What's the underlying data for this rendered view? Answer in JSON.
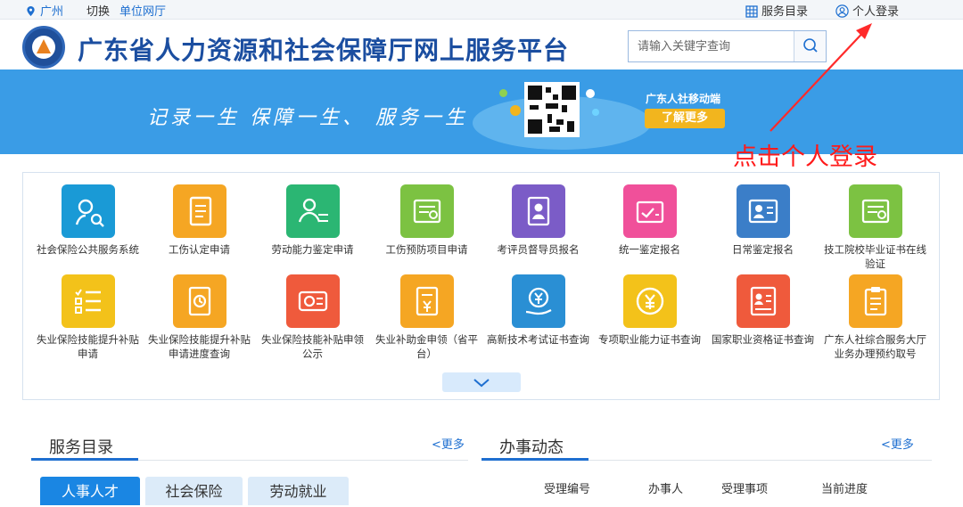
{
  "topbar": {
    "city": "广州",
    "switch": "切换",
    "unit_hall": "单位网厅",
    "service_catalog": "服务目录",
    "personal_login": "个人登录"
  },
  "header": {
    "title": "广东省人力资源和社会保障厅网上服务平台",
    "search_placeholder": "请输入关键字查询"
  },
  "banner": {
    "slogan": "记录一生  保障一生、 服务一生",
    "mobile_label": "广东人社移动端",
    "learn_more": "了解更多"
  },
  "annotation": {
    "text": "点击个人登录",
    "color": "#ff1a1a"
  },
  "services": [
    {
      "label": "社会保险公共服务系统",
      "icon": "search-user-icon",
      "color": "#1a9ad6"
    },
    {
      "label": "工伤认定申请",
      "icon": "document-icon",
      "color": "#f5a623"
    },
    {
      "label": "劳动能力鉴定申请",
      "icon": "users-exchange-icon",
      "color": "#2bb673"
    },
    {
      "label": "工伤预防项目申请",
      "icon": "certificate-icon",
      "color": "#7cc242"
    },
    {
      "label": "考评员督导员报名",
      "icon": "id-badge-icon",
      "color": "#7b5cc7"
    },
    {
      "label": "统一鉴定报名",
      "icon": "signup-card-icon",
      "color": "#f0509a"
    },
    {
      "label": "日常鉴定报名",
      "icon": "profile-card-icon",
      "color": "#3b7ec8"
    },
    {
      "label": "技工院校毕业证书在线验证",
      "icon": "diploma-icon",
      "color": "#7cc242"
    },
    {
      "label": "失业保险技能提升补贴申请",
      "icon": "checklist-icon",
      "color": "#f3c21a"
    },
    {
      "label": "失业保险技能提升补贴申请进度查询",
      "icon": "progress-doc-icon",
      "color": "#f5a623"
    },
    {
      "label": "失业保险技能补贴申领公示",
      "icon": "bank-card-icon",
      "color": "#ef5a3c"
    },
    {
      "label": "失业补助金申领（省平台）",
      "icon": "yuan-doc-icon",
      "color": "#f5a623"
    },
    {
      "label": "高新技术考试证书查询",
      "icon": "yuan-hand-icon",
      "color": "#2a8fd4"
    },
    {
      "label": "专项职业能力证书查询",
      "icon": "yuan-coin-icon",
      "color": "#f3c21a"
    },
    {
      "label": "国家职业资格证书查询",
      "icon": "id-card-icon",
      "color": "#ef5a3c"
    },
    {
      "label": "广东人社综合服务大厅业务办理预约取号",
      "icon": "clipboard-icon",
      "color": "#f5a623"
    }
  ],
  "service_section": {
    "title": "服务目录",
    "more": "<更多",
    "tabs": [
      "人事人才",
      "社会保险",
      "劳动就业"
    ]
  },
  "news_section": {
    "title": "办事动态",
    "more": "<更多",
    "columns": [
      "受理编号",
      "办事人",
      "受理事项",
      "当前进度"
    ]
  }
}
